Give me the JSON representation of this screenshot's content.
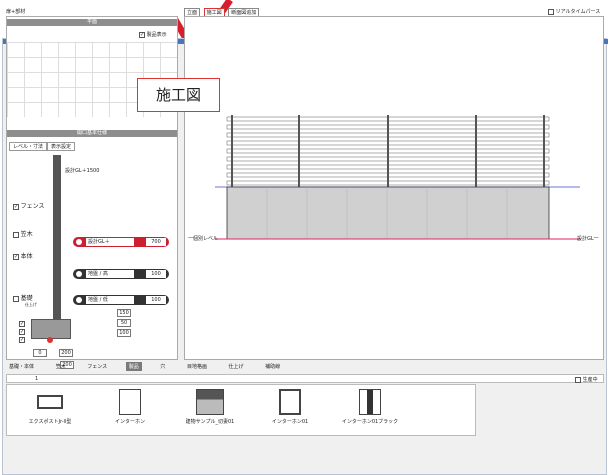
{
  "left_panel": {
    "title": "扉+部材",
    "plan_header": "平面",
    "show_product_label": "製品表示",
    "settings_header": "開口基本仕様",
    "tabs": [
      "レベル・寸法",
      "表示設定"
    ],
    "top_level_label": "設計GL＋1500",
    "checks": [
      {
        "label": "フェンス",
        "checked": true
      },
      {
        "label": "笠木",
        "checked": false
      },
      {
        "label": "本体",
        "checked": true
      },
      {
        "label": "基礎",
        "checked": false
      }
    ],
    "base_note": "仕上げ",
    "controls": [
      {
        "label": "設計GL＋",
        "value": "700",
        "active": true
      },
      {
        "label": "地盤 / 高",
        "value": "100",
        "active": false
      },
      {
        "label": "地盤 / 低",
        "value": "100",
        "active": false
      }
    ],
    "dims": [
      "150",
      "50",
      "100",
      "0",
      "200",
      "200"
    ]
  },
  "view": {
    "tabs": [
      "立面",
      "施工図",
      "断面図追加"
    ],
    "realtime_label": "リアルタイムパース",
    "label_left": "一個別レベル",
    "label_right": "設計GL一"
  },
  "callout": "施工図",
  "bottom_tabs": [
    "基礎・本体",
    "笠木",
    "フェンス",
    "製品",
    "穴",
    "目地格画",
    "仕上げ",
    "補助線"
  ],
  "bottom_active": 3,
  "filter": {
    "page": "1",
    "right_label": "生産中"
  },
  "catalog_items": [
    {
      "label": "エクスポストJr-ll型",
      "icon": "mailbox-icon"
    },
    {
      "label": "インターホン",
      "icon": "intercom-icon"
    },
    {
      "label": "建物サンプル_切妻01",
      "icon": "house-icon"
    },
    {
      "label": "インターホン01",
      "icon": "intercom-icon"
    },
    {
      "label": "インターホン01ブラック",
      "icon": "intercom-black-icon"
    }
  ],
  "colors": {
    "accent_red": "#cc1f30",
    "slat": "#8a8a8a",
    "base": "#d0d0d0",
    "guide_pink": "#e0206a",
    "guide_blue": "#3b49c6"
  }
}
